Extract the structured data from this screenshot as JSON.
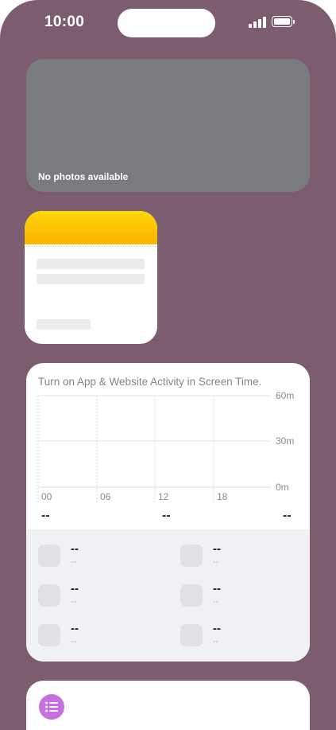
{
  "status_bar": {
    "time": "10:00"
  },
  "photos_widget": {
    "message": "No photos available"
  },
  "screen_time": {
    "prompt": "Turn on App & Website Activity in Screen Time.",
    "y_axis": [
      "60m",
      "30m",
      "0m"
    ],
    "x_axis": [
      "00",
      "06",
      "12",
      "18"
    ],
    "totals": [
      "--",
      "--",
      "--"
    ],
    "apps": [
      {
        "name": "--",
        "time": "--"
      },
      {
        "name": "--",
        "time": "--"
      },
      {
        "name": "--",
        "time": "--"
      },
      {
        "name": "--",
        "time": "--"
      },
      {
        "name": "--",
        "time": "--"
      },
      {
        "name": "--",
        "time": "--"
      }
    ]
  },
  "colors": {
    "wallpaper": "#7b5d6f",
    "notes_accent": "#ffd60a",
    "reminders_accent": "#c76ee0",
    "photo_placeholder": "#7a7b7e"
  },
  "icons": [
    "signal-icon",
    "battery-icon",
    "reminders-list-icon"
  ]
}
